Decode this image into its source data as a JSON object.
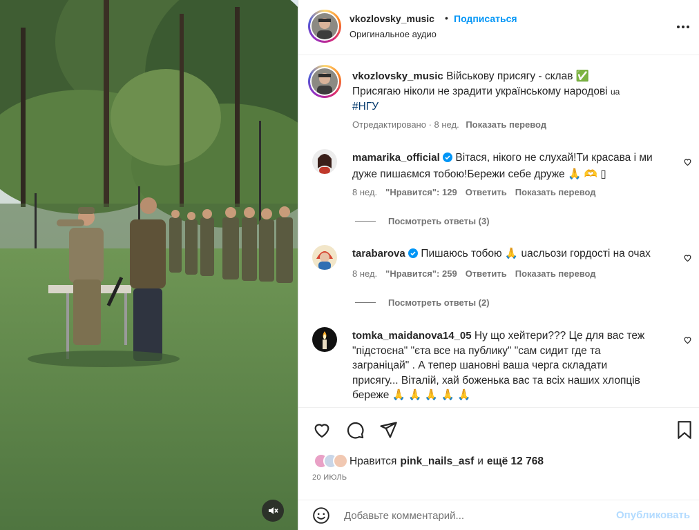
{
  "header": {
    "username": "vkozlovsky_music",
    "dot": "•",
    "follow_label": "Подписаться",
    "audio": "Оригинальное аудио",
    "more_icon": "more-horizontal-icon"
  },
  "caption": {
    "username": "vkozlovsky_music",
    "text_line1": "Військову присягу - склав ✅",
    "text_line2": "Присягаю ніколи не зрадити українському народові",
    "flag_text": "ua",
    "hashtag": "#НГУ",
    "edited": "Отредактировано · 8 нед.",
    "translate": "Показать перевод"
  },
  "comments": [
    {
      "username": "mamarika_official",
      "verified": true,
      "text_a": "Вітася, нікого не слухай!Ти красава і ми",
      "text_b": "дуже пишаємся тобою!Бережи себе друже 🙏 🫶 ▯",
      "time": "8 нед.",
      "likes": "\"Нравится\": 129",
      "reply": "Ответить",
      "translate": "Показать перевод",
      "replies": "Посмотреть ответы (3)"
    },
    {
      "username": "tarabarova",
      "verified": true,
      "text_a": "Пишаюсь тобою 🙏 uaсльози гордості на очах",
      "time": "8 нед.",
      "likes": "\"Нравится\": 259",
      "reply": "Ответить",
      "translate": "Показать перевод",
      "replies": "Посмотреть ответы (2)"
    },
    {
      "username": "tomka_maidanova14_05",
      "verified": false,
      "text_a": "Ну що хейтери??? Це для вас теж",
      "text_b": "\"підстоєна\" \"єта все на публику\" \"сам сидит где та",
      "text_c": "заграніцай\" . А тепер шановні ваша черга складати",
      "text_d": "присягу... Віталій, хай боженька вас та всіх наших хлопців",
      "text_e": "береже 🙏 🙏 🙏 🙏 🙏"
    }
  ],
  "likes": {
    "prefix": "Нравится",
    "user": "pink_nails_asf",
    "middle": "и",
    "rest": "ещё 12 768"
  },
  "date": "20 ИЮЛЬ",
  "add_comment": {
    "placeholder": "Добавьте комментарий...",
    "publish": "Опубликовать"
  },
  "colors": {
    "accent": "#0095f6",
    "publish_disabled": "#b3dbff",
    "link": "#00376b",
    "secondary_text": "#737373"
  }
}
